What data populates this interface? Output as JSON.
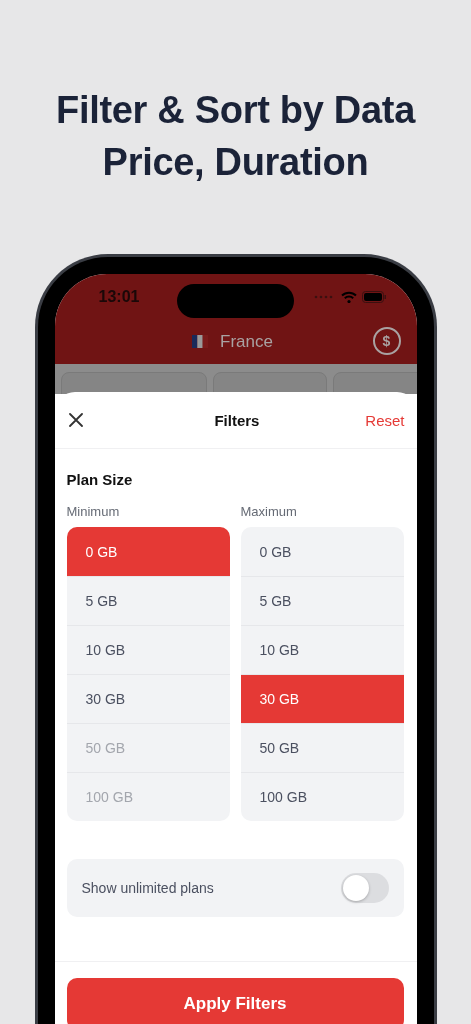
{
  "headline": "Filter & Sort by Data Price, Duration",
  "status_bar": {
    "time": "13:01"
  },
  "header": {
    "country": "France",
    "currency_symbol": "$"
  },
  "sheet": {
    "title": "Filters",
    "reset": "Reset",
    "section": "Plan Size",
    "columns": [
      {
        "label": "Minimum",
        "options": [
          {
            "label": "0 GB",
            "selected": true,
            "disabled": false
          },
          {
            "label": "5 GB",
            "selected": false,
            "disabled": false
          },
          {
            "label": "10 GB",
            "selected": false,
            "disabled": false
          },
          {
            "label": "30 GB",
            "selected": false,
            "disabled": false
          },
          {
            "label": "50 GB",
            "selected": false,
            "disabled": true
          },
          {
            "label": "100 GB",
            "selected": false,
            "disabled": true
          }
        ]
      },
      {
        "label": "Maximum",
        "options": [
          {
            "label": "0 GB",
            "selected": false,
            "disabled": false
          },
          {
            "label": "5 GB",
            "selected": false,
            "disabled": false
          },
          {
            "label": "10 GB",
            "selected": false,
            "disabled": false
          },
          {
            "label": "30 GB",
            "selected": true,
            "disabled": false
          },
          {
            "label": "50 GB",
            "selected": false,
            "disabled": false
          },
          {
            "label": "100 GB",
            "selected": false,
            "disabled": false
          }
        ]
      }
    ],
    "toggle": {
      "label": "Show unlimited plans",
      "on": false
    },
    "apply": "Apply Filters"
  }
}
